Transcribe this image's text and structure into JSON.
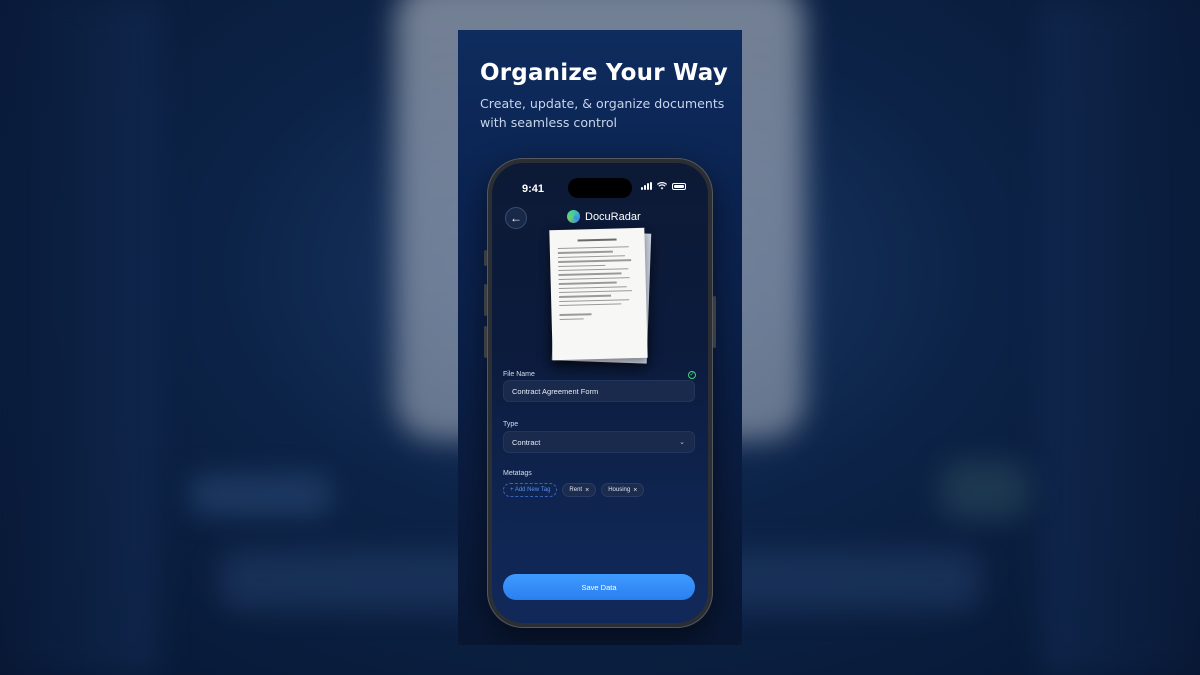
{
  "marketing": {
    "headline": "Organize Your Way",
    "subheadline": "Create, update, & organize documents with seamless control"
  },
  "status_bar": {
    "time": "9:41"
  },
  "app": {
    "brand_name": "DocuRadar",
    "back_icon": "arrow-left-icon",
    "logo_icon": "docuradar-logo-icon"
  },
  "form": {
    "file_name_label": "File Name",
    "file_name_value": "Contract Agreement Form",
    "file_name_valid_icon": "check-circle-icon",
    "type_label": "Type",
    "type_value": "Contract",
    "metatags_label": "Metatags",
    "add_tag_label": "+ Add New Tag",
    "tags": [
      {
        "label": "Rent"
      },
      {
        "label": "Housing"
      }
    ],
    "save_label": "Save Data"
  },
  "colors": {
    "accent": "#2a7ff0",
    "success": "#42d37a",
    "background": "#0b2350"
  }
}
